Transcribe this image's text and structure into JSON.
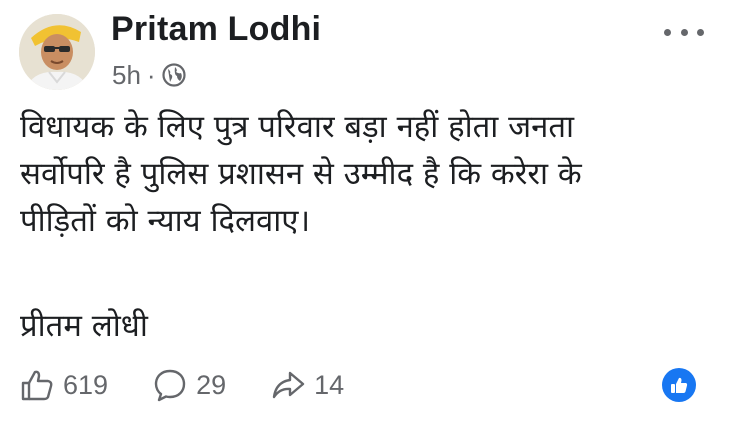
{
  "post": {
    "author": "Pritam Lodhi",
    "time": "5h",
    "separator": "·",
    "audience_icon": "globe-icon",
    "more_icon": "more-options-icon",
    "body_lines": [
      "विधायक के लिए पुत्र परिवार बड़ा नहीं होता जनता",
      "सर्वोपरि है पुलिस प्रशासन से उम्मीद है कि करेरा के",
      "पीड़ितों को न्याय दिलवाए।"
    ],
    "signature": "प्रीतम लोधी",
    "actions": {
      "like": {
        "icon": "thumbs-up-icon",
        "count": "619"
      },
      "comment": {
        "icon": "comment-bubble-icon",
        "count": "29"
      },
      "share": {
        "icon": "share-arrow-icon",
        "count": "14"
      }
    },
    "reaction_badge_icon": "like-reaction-icon"
  },
  "colors": {
    "text_primary": "#1c1e21",
    "text_secondary": "#65676b",
    "facebook_blue": "#1877f2",
    "background": "#ffffff"
  }
}
